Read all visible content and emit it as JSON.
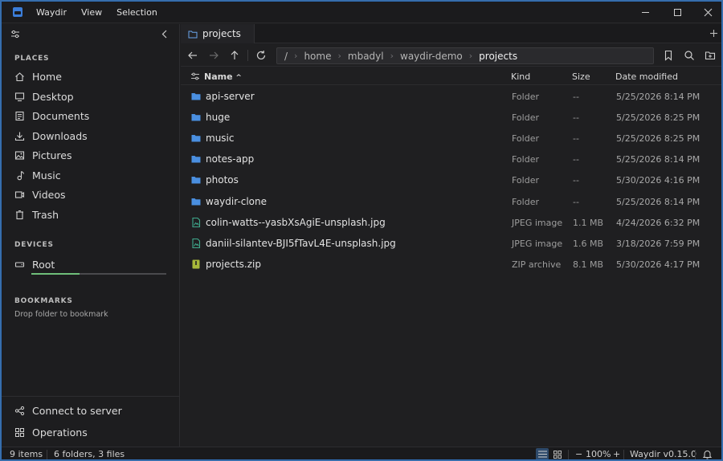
{
  "titlebar": {
    "menu": [
      "Waydir",
      "View",
      "Selection"
    ]
  },
  "sidebar": {
    "places_label": "PLACES",
    "places": [
      {
        "label": "Home",
        "icon": "home-icon"
      },
      {
        "label": "Desktop",
        "icon": "desktop-icon"
      },
      {
        "label": "Documents",
        "icon": "documents-icon"
      },
      {
        "label": "Downloads",
        "icon": "downloads-icon"
      },
      {
        "label": "Pictures",
        "icon": "pictures-icon"
      },
      {
        "label": "Music",
        "icon": "music-icon"
      },
      {
        "label": "Videos",
        "icon": "videos-icon"
      },
      {
        "label": "Trash",
        "icon": "trash-icon"
      }
    ],
    "devices_label": "DEVICES",
    "devices": [
      {
        "label": "Root",
        "usage_fraction": 0.36
      }
    ],
    "bookmarks_label": "BOOKMARKS",
    "bookmarks_hint": "Drop folder to bookmark",
    "bottom": [
      {
        "label": "Connect to server",
        "icon": "network-icon"
      },
      {
        "label": "Operations",
        "icon": "operations-icon"
      }
    ]
  },
  "tabs": [
    {
      "label": "projects"
    }
  ],
  "breadcrumb": {
    "root": "/",
    "parts": [
      "home",
      "mbadyl",
      "waydir-demo",
      "projects"
    ]
  },
  "columns": {
    "name": "Name",
    "kind": "Kind",
    "size": "Size",
    "date": "Date modified"
  },
  "files": [
    {
      "name": "api-server",
      "kind": "Folder",
      "size": "--",
      "date": "5/25/2026 8:14 PM",
      "type": "folder"
    },
    {
      "name": "huge",
      "kind": "Folder",
      "size": "--",
      "date": "5/25/2026 8:25 PM",
      "type": "folder"
    },
    {
      "name": "music",
      "kind": "Folder",
      "size": "--",
      "date": "5/25/2026 8:25 PM",
      "type": "folder"
    },
    {
      "name": "notes-app",
      "kind": "Folder",
      "size": "--",
      "date": "5/25/2026 8:14 PM",
      "type": "folder"
    },
    {
      "name": "photos",
      "kind": "Folder",
      "size": "--",
      "date": "5/30/2026 4:16 PM",
      "type": "folder"
    },
    {
      "name": "waydir-clone",
      "kind": "Folder",
      "size": "--",
      "date": "5/25/2026 8:14 PM",
      "type": "folder"
    },
    {
      "name": "colin-watts--yasbXsAgiE-unsplash.jpg",
      "kind": "JPEG image",
      "size": "1.1 MB",
      "date": "4/24/2026 6:32 PM",
      "type": "image"
    },
    {
      "name": "daniil-silantev-BJI5fTavL4E-unsplash.jpg",
      "kind": "JPEG image",
      "size": "1.6 MB",
      "date": "3/18/2026 7:59 PM",
      "type": "image"
    },
    {
      "name": "projects.zip",
      "kind": "ZIP archive",
      "size": "8.1 MB",
      "date": "5/30/2026 4:17 PM",
      "type": "zip"
    }
  ],
  "status": {
    "count": "9 items",
    "summary": "6 folders, 3 files",
    "zoom_minus": "−",
    "zoom": "100%",
    "zoom_plus": "+",
    "version": "Waydir v0.15.0"
  },
  "colors": {
    "folder": "#4a8fe0",
    "image": "#3fa98c",
    "zip": "#a7b83a",
    "accent": "#2f6db5",
    "usage": "#6fbf7a"
  }
}
